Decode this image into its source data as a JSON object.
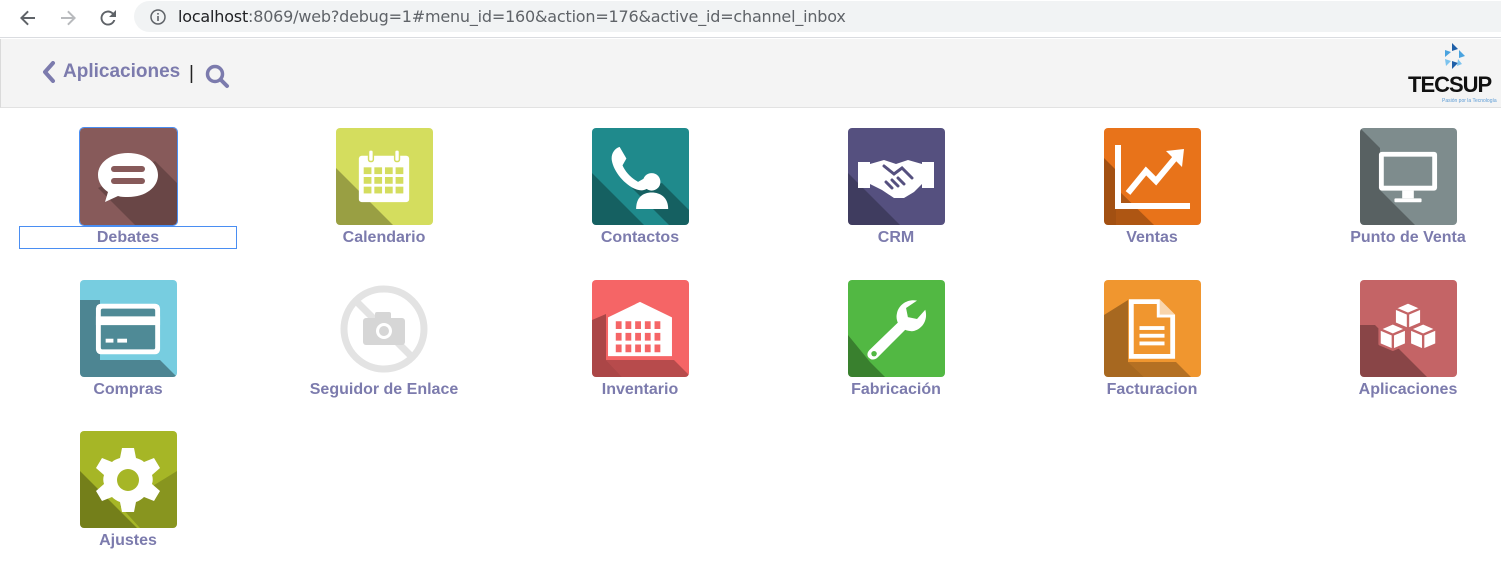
{
  "browser": {
    "url_host": "localhost",
    "url_rest": ":8069/web?debug=1#menu_id=160&action=176&active_id=channel_inbox"
  },
  "header": {
    "back_label": "Aplicaciones",
    "separator": "|",
    "logo_text": "TECSUP",
    "logo_tagline": "Pasión por la Tecnología"
  },
  "apps": [
    {
      "label": "Debates",
      "icon": "chat-bubble-icon",
      "color": "#875a5a"
    },
    {
      "label": "Calendario",
      "icon": "calendar-icon",
      "color": "#d4dd5e"
    },
    {
      "label": "Contactos",
      "icon": "contact-phone-icon",
      "color": "#1f8a8c"
    },
    {
      "label": "CRM",
      "icon": "handshake-icon",
      "color": "#55507f"
    },
    {
      "label": "Ventas",
      "icon": "trend-chart-icon",
      "color": "#e8731a"
    },
    {
      "label": "Punto de Venta",
      "icon": "monitor-icon",
      "color": "#7e8c8d"
    },
    {
      "label": "Compras",
      "icon": "credit-card-icon",
      "color": "#77cde0"
    },
    {
      "label": "Seguidor de Enlace",
      "icon": "no-image-icon",
      "color": "#ffffff"
    },
    {
      "label": "Inventario",
      "icon": "warehouse-icon",
      "color": "#f56566"
    },
    {
      "label": "Fabricación",
      "icon": "wrench-icon",
      "color": "#52b843"
    },
    {
      "label": "Facturacion",
      "icon": "invoice-icon",
      "color": "#f0962f"
    },
    {
      "label": "Aplicaciones",
      "icon": "cubes-icon",
      "color": "#c46466"
    },
    {
      "label": "Ajustes",
      "icon": "gear-icon",
      "color": "#a6b626"
    }
  ]
}
